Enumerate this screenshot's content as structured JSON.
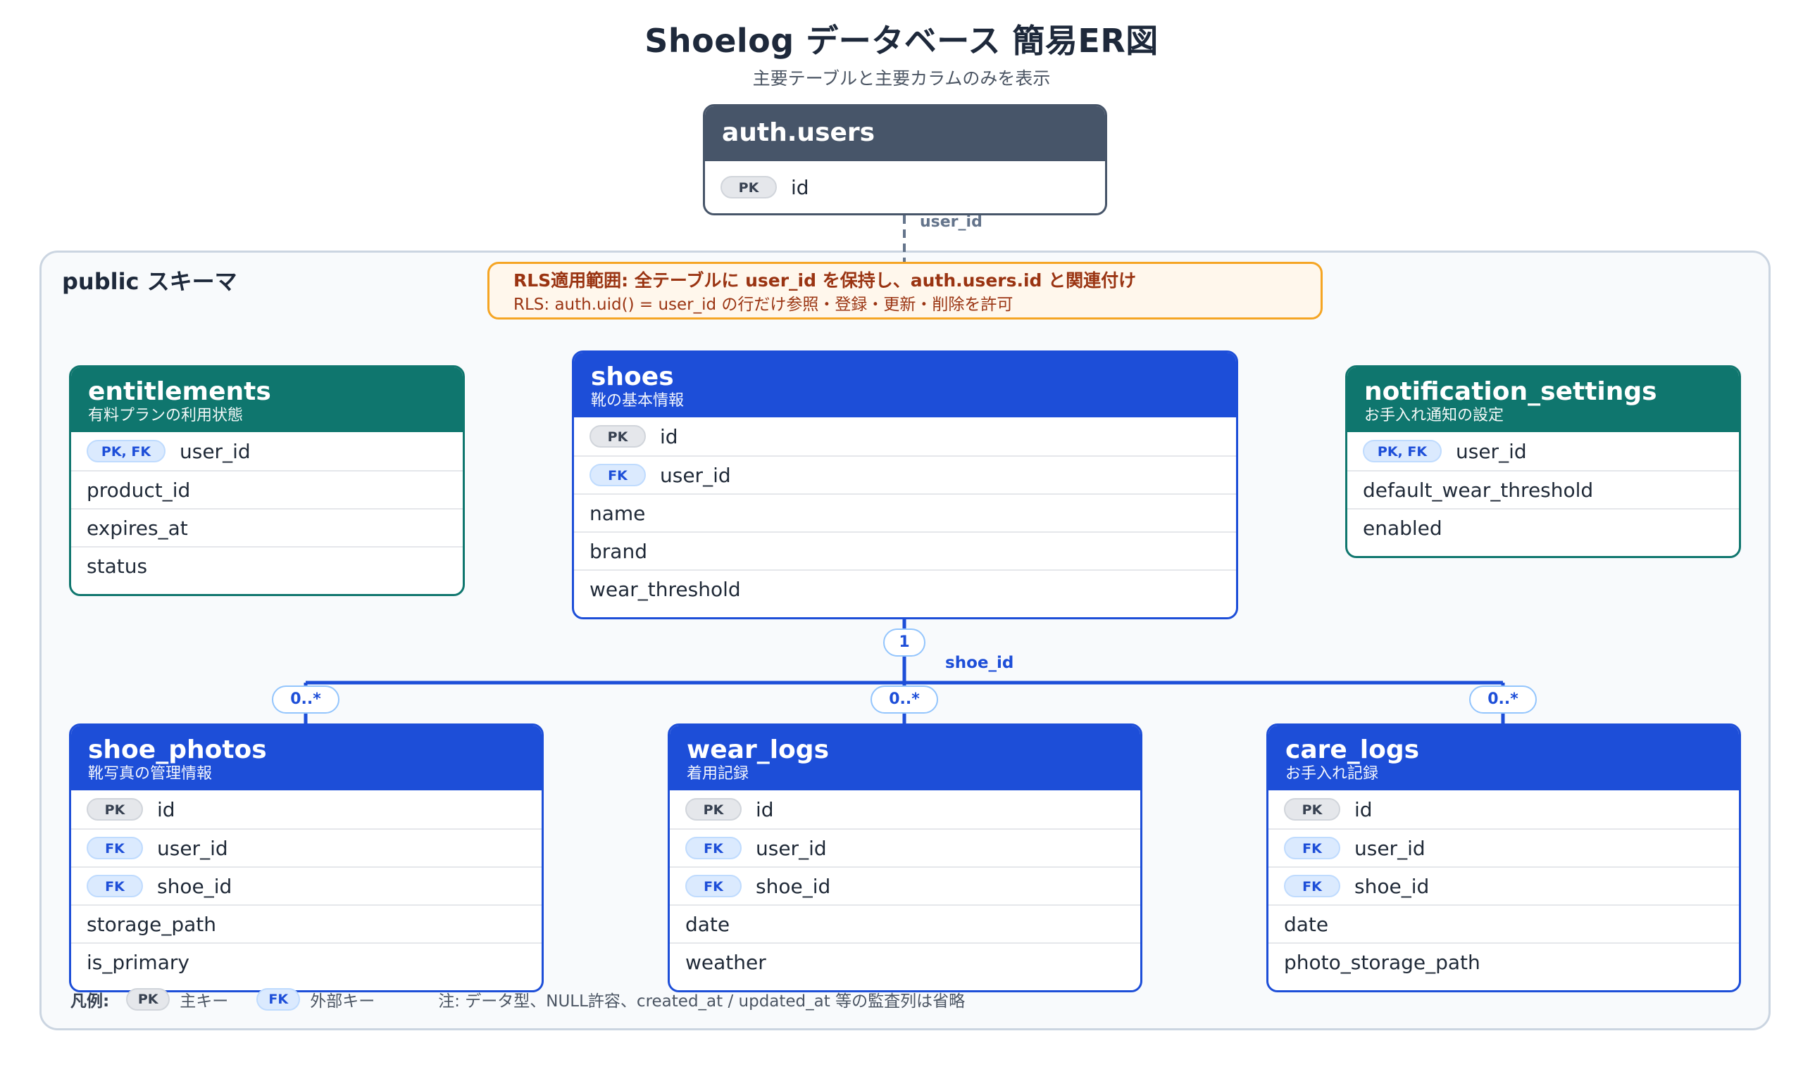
{
  "title": "Shoelog データベース 簡易ER図",
  "subtitle": "主要テーブルと主要カラムのみを表示",
  "schema_label": "public スキーマ",
  "rls": {
    "line1": "RLS適用範囲: 全テーブルに user_id を保持し、auth.users.id と関連付け",
    "line2": "RLS: auth.uid() = user_id の行だけ参照・登録・更新・削除を許可"
  },
  "relations": {
    "auth_label": "user_id",
    "shoe_label": "shoe_id",
    "one": "1",
    "many": "0..*"
  },
  "colors": {
    "gray": "#475569",
    "green": "#0f766e",
    "blue": "#1d4ed8",
    "rls_border": "#f5a524"
  },
  "entities": {
    "auth_users": {
      "name": "auth.users",
      "columns": [
        {
          "key": "PK",
          "name": "id"
        }
      ]
    },
    "entitlements": {
      "name": "entitlements",
      "desc": "有料プランの利用状態",
      "columns": [
        {
          "key": "PK, FK",
          "name": "user_id"
        },
        {
          "key": "",
          "name": "product_id"
        },
        {
          "key": "",
          "name": "expires_at"
        },
        {
          "key": "",
          "name": "status"
        }
      ]
    },
    "shoes": {
      "name": "shoes",
      "desc": "靴の基本情報",
      "columns": [
        {
          "key": "PK",
          "name": "id"
        },
        {
          "key": "FK",
          "name": "user_id"
        },
        {
          "key": "",
          "name": "name"
        },
        {
          "key": "",
          "name": "brand"
        },
        {
          "key": "",
          "name": "wear_threshold"
        }
      ]
    },
    "notification_settings": {
      "name": "notification_settings",
      "desc": "お手入れ通知の設定",
      "columns": [
        {
          "key": "PK, FK",
          "name": "user_id"
        },
        {
          "key": "",
          "name": "default_wear_threshold"
        },
        {
          "key": "",
          "name": "enabled"
        }
      ]
    },
    "shoe_photos": {
      "name": "shoe_photos",
      "desc": "靴写真の管理情報",
      "columns": [
        {
          "key": "PK",
          "name": "id"
        },
        {
          "key": "FK",
          "name": "user_id"
        },
        {
          "key": "FK",
          "name": "shoe_id"
        },
        {
          "key": "",
          "name": "storage_path"
        },
        {
          "key": "",
          "name": "is_primary"
        }
      ]
    },
    "wear_logs": {
      "name": "wear_logs",
      "desc": "着用記録",
      "columns": [
        {
          "key": "PK",
          "name": "id"
        },
        {
          "key": "FK",
          "name": "user_id"
        },
        {
          "key": "FK",
          "name": "shoe_id"
        },
        {
          "key": "",
          "name": "date"
        },
        {
          "key": "",
          "name": "weather"
        }
      ]
    },
    "care_logs": {
      "name": "care_logs",
      "desc": "お手入れ記録",
      "columns": [
        {
          "key": "PK",
          "name": "id"
        },
        {
          "key": "FK",
          "name": "user_id"
        },
        {
          "key": "FK",
          "name": "shoe_id"
        },
        {
          "key": "",
          "name": "date"
        },
        {
          "key": "",
          "name": "photo_storage_path"
        }
      ]
    }
  },
  "legend": {
    "title": "凡例:",
    "pk_badge": "PK",
    "pk_text": "主キー",
    "fk_badge": "FK",
    "fk_text": "外部キー",
    "note": "注: データ型、NULL許容、created_at / updated_at 等の監査列は省略"
  }
}
